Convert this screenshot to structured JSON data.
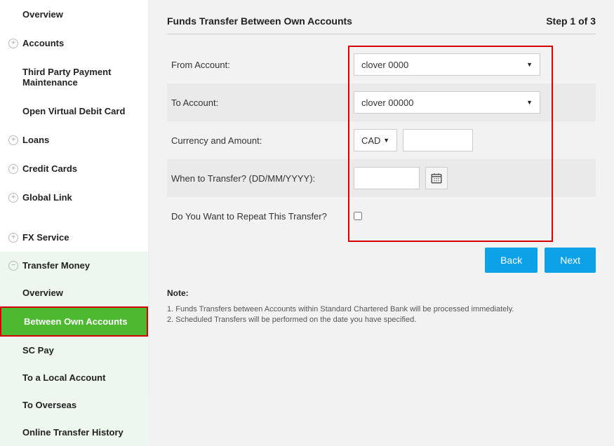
{
  "sidebar": {
    "items": [
      {
        "label": "Overview",
        "expander": null
      },
      {
        "label": "Accounts",
        "expander": "+"
      },
      {
        "label": "Third Party Payment Maintenance",
        "expander": null
      },
      {
        "label": "Open Virtual Debit Card",
        "expander": null
      },
      {
        "label": "Loans",
        "expander": "+"
      },
      {
        "label": "Credit Cards",
        "expander": "+"
      },
      {
        "label": "Global Link",
        "expander": "+"
      },
      {
        "label": "FX Service",
        "expander": "+"
      },
      {
        "label": "Transfer Money",
        "expander": "−"
      }
    ],
    "transfer_sub": [
      {
        "label": "Overview"
      },
      {
        "label": "Between Own Accounts"
      },
      {
        "label": "SC Pay"
      },
      {
        "label": "To a Local Account"
      },
      {
        "label": "To Overseas"
      },
      {
        "label": "Online Transfer History"
      }
    ]
  },
  "header": {
    "title": "Funds Transfer Between Own Accounts",
    "step": "Step 1 of 3"
  },
  "form": {
    "from_label": "From Account:",
    "from_value": "clover 0000",
    "to_label": "To Account:",
    "to_value": "clover 00000",
    "currency_label": "Currency and Amount:",
    "currency_value": "CAD",
    "amount_value": "",
    "when_label": "When to Transfer? (DD/MM/YYYY):",
    "date_value": "",
    "repeat_label": "Do You Want to Repeat This Transfer?"
  },
  "buttons": {
    "back": "Back",
    "next": "Next"
  },
  "notes": {
    "title": "Note:",
    "line1": "1. Funds Transfers between Accounts within Standard Chartered Bank will be processed immediately.",
    "line2": "2. Scheduled Transfers will be performed on the date you have specified."
  }
}
